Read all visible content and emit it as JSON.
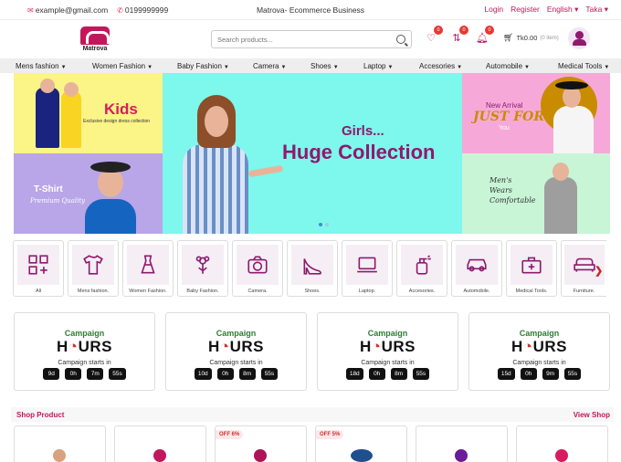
{
  "topbar": {
    "email": "example@gmail.com",
    "phone": "0199999999",
    "title": "Matrova- Ecommerce Business",
    "login": "Login",
    "register": "Register",
    "language": "English",
    "currency": "Taka"
  },
  "header": {
    "logo_text": "Matrova",
    "search_placeholder": "Search products...",
    "wishlist_count": "0",
    "compare_count": "0",
    "notify_count": "0",
    "cart_total": "Tk0.00",
    "cart_items": "(0 item)"
  },
  "nav": [
    "Mens fashion",
    "Women Fashion",
    "Baby Fashion",
    "Camera",
    "Shoes",
    "Laptop",
    "Accesories",
    "Automobile",
    "Medical Tools"
  ],
  "hero": {
    "kids_title": "Kids",
    "kids_sub": "Exclusive design dress collection",
    "tshirt_title": "T-Shirt",
    "tshirt_sub": "Premium Quality",
    "girls_title": "Girls...",
    "girls_sub": "Huge Collection",
    "arrival_line1": "New Arrival",
    "arrival_line2": "JUST FOR",
    "arrival_line3": "You",
    "mens_line": "Men's Wears Comfortable"
  },
  "categories": [
    {
      "label": "All",
      "icon": "grid-icon"
    },
    {
      "label": "Mens fashion.",
      "icon": "tshirt-icon"
    },
    {
      "label": "Women Fashion.",
      "icon": "dress-icon"
    },
    {
      "label": "Baby Fashion.",
      "icon": "flower-icon"
    },
    {
      "label": "Camera.",
      "icon": "camera-icon"
    },
    {
      "label": "Shoes.",
      "icon": "heel-icon"
    },
    {
      "label": "Laptop.",
      "icon": "laptop-icon"
    },
    {
      "label": "Accesories.",
      "icon": "spray-icon"
    },
    {
      "label": "Automobile.",
      "icon": "car-icon"
    },
    {
      "label": "Medical Tools.",
      "icon": "medkit-icon"
    },
    {
      "label": "Furniture.",
      "icon": "sofa-icon"
    }
  ],
  "campaigns": [
    {
      "title": "Campaign",
      "hours_a": "H",
      "hours_b": "URS",
      "starts": "Campaign starts in",
      "d": "9d",
      "h": "0h",
      "m": "7m",
      "s": "55s"
    },
    {
      "title": "Campaign",
      "hours_a": "H",
      "hours_b": "URS",
      "starts": "Campaign starts in",
      "d": "10d",
      "h": "0h",
      "m": "8m",
      "s": "55s"
    },
    {
      "title": "Campaign",
      "hours_a": "H",
      "hours_b": "URS",
      "starts": "Campaign starts in",
      "d": "18d",
      "h": "0h",
      "m": "8m",
      "s": "55s"
    },
    {
      "title": "Campaign",
      "hours_a": "H",
      "hours_b": "URS",
      "starts": "Campaign starts in",
      "d": "15d",
      "h": "0h",
      "m": "9m",
      "s": "55s"
    }
  ],
  "shop": {
    "title": "Shop Product",
    "view": "View Shop",
    "offers": [
      "",
      "",
      "OFF 6%",
      "OFF 5%",
      "",
      ""
    ]
  },
  "colors": {
    "brand": "#c2185b",
    "accent": "#8e1a6e",
    "green": "#2e7d32"
  }
}
